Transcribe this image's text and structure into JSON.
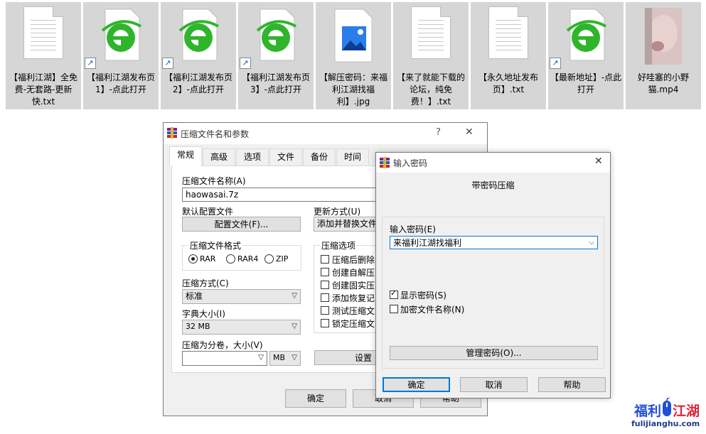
{
  "desktop": {
    "files": [
      {
        "label": "【福利江湖】全免费-无套路-更新快.txt",
        "kind": "text"
      },
      {
        "label": "【福利江湖发布页1】-点此打开",
        "kind": "ie-shortcut"
      },
      {
        "label": "【福利江湖发布页2】-点此打开",
        "kind": "ie-shortcut"
      },
      {
        "label": "【福利江湖发布页3】-点此打开",
        "kind": "ie-shortcut"
      },
      {
        "label": "【解压密码：来福利江湖找福利】.jpg",
        "kind": "image"
      },
      {
        "label": "【来了就能下载的论坛，纯免费！】.txt",
        "kind": "text"
      },
      {
        "label": "【永久地址发布页】.txt",
        "kind": "text"
      },
      {
        "label": "【最新地址】-点此打开",
        "kind": "ie-shortcut"
      },
      {
        "label": "好哇塞的小野猫.mp4",
        "kind": "video"
      }
    ]
  },
  "archive_dialog": {
    "title": "压缩文件名和参数",
    "help": "?",
    "close": "✕",
    "tabs": [
      "常规",
      "高级",
      "选项",
      "文件",
      "备份",
      "时间"
    ],
    "archive_name_label": "压缩文件名称(A)",
    "archive_name_value": "haowasai.7z",
    "profile_label": "默认配置文件",
    "profile_button": "配置文件(F)...",
    "update_label": "更新方式(U)",
    "update_value": "添加并替换文件",
    "format_group": "压缩文件格式",
    "formats": [
      "RAR",
      "RAR4",
      "ZIP"
    ],
    "method_label": "压缩方式(C)",
    "method_value": "标准",
    "dict_label": "字典大小(I)",
    "dict_value": "32 MB",
    "split_label": "压缩为分卷，大小(V)",
    "split_unit": "MB",
    "options_group": "压缩选项",
    "options": [
      "压缩后删除",
      "创建自解压",
      "创建固实压",
      "添加恢复记",
      "测试压缩文",
      "锁定压缩文"
    ],
    "settings_button": "设置",
    "ok": "确定",
    "cancel": "取消",
    "help_button": "帮助"
  },
  "password_dialog": {
    "title": "输入密码",
    "close": "✕",
    "heading": "带密码压缩",
    "password_label": "输入密码(E)",
    "password_value": "来福利江湖找福利",
    "show_password": "显示密码(S)",
    "encrypt_names": "加密文件名称(N)",
    "manage_button": "管理密码(O)...",
    "ok": "确定",
    "cancel": "取消",
    "help": "帮助"
  },
  "watermark": {
    "title_left": "福利",
    "title_right": "江湖",
    "url": "fulijianghu.com"
  },
  "colors": {
    "accent": "#0078d7",
    "ie_green": "#2fb52b",
    "watermark_blue": "#1f4fd8",
    "watermark_red": "#e0243a"
  }
}
